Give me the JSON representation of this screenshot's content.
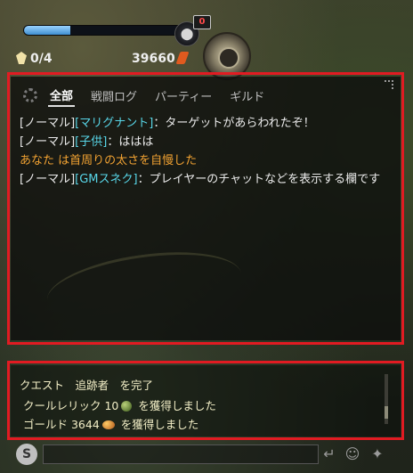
{
  "hud": {
    "exp_progress": 0.28,
    "notification_count": "0",
    "quest_count": "0/4",
    "gold_amount": "39660"
  },
  "chat": {
    "tabs": [
      {
        "label": "全部",
        "active": true
      },
      {
        "label": "戦闘ログ"
      },
      {
        "label": "パーティー"
      },
      {
        "label": "ギルド"
      }
    ],
    "messages": [
      {
        "channel": "[ノーマル]",
        "name": "[マリグナント]",
        "text": "：ターゲットがあらわれたぞ！"
      },
      {
        "channel": "[ノーマル]",
        "name": "[子供]",
        "text": "：ははは"
      },
      {
        "emote": "あなた は首周りの太さを自慢した"
      },
      {
        "channel": "[ノーマル]",
        "name": "[GMスネク]",
        "text": "：プレイヤーのチャットなどを表示する欄です"
      }
    ]
  },
  "system": {
    "line1": "クエスト　追跡者　を完了",
    "line2_pre": "クールレリック 10",
    "line2_post": " を獲得しました",
    "line3_pre": "ゴールド 3644",
    "line3_post": " を獲得しました"
  },
  "input": {
    "say_icon": "S",
    "value": ""
  },
  "icons": {
    "settings": "gear-icon",
    "gamepad": "gamepad-icon",
    "compass": "compass-icon",
    "quest": "quest-icon",
    "gold": "gold-ore-icon",
    "enter": "enter-icon",
    "emote": "emote-icon",
    "action": "run-icon"
  },
  "colors": {
    "highlight_box": "#e11b22",
    "name_color": "#58d6e8",
    "emote_color": "#f1a232",
    "system_text": "#f2eec6"
  }
}
